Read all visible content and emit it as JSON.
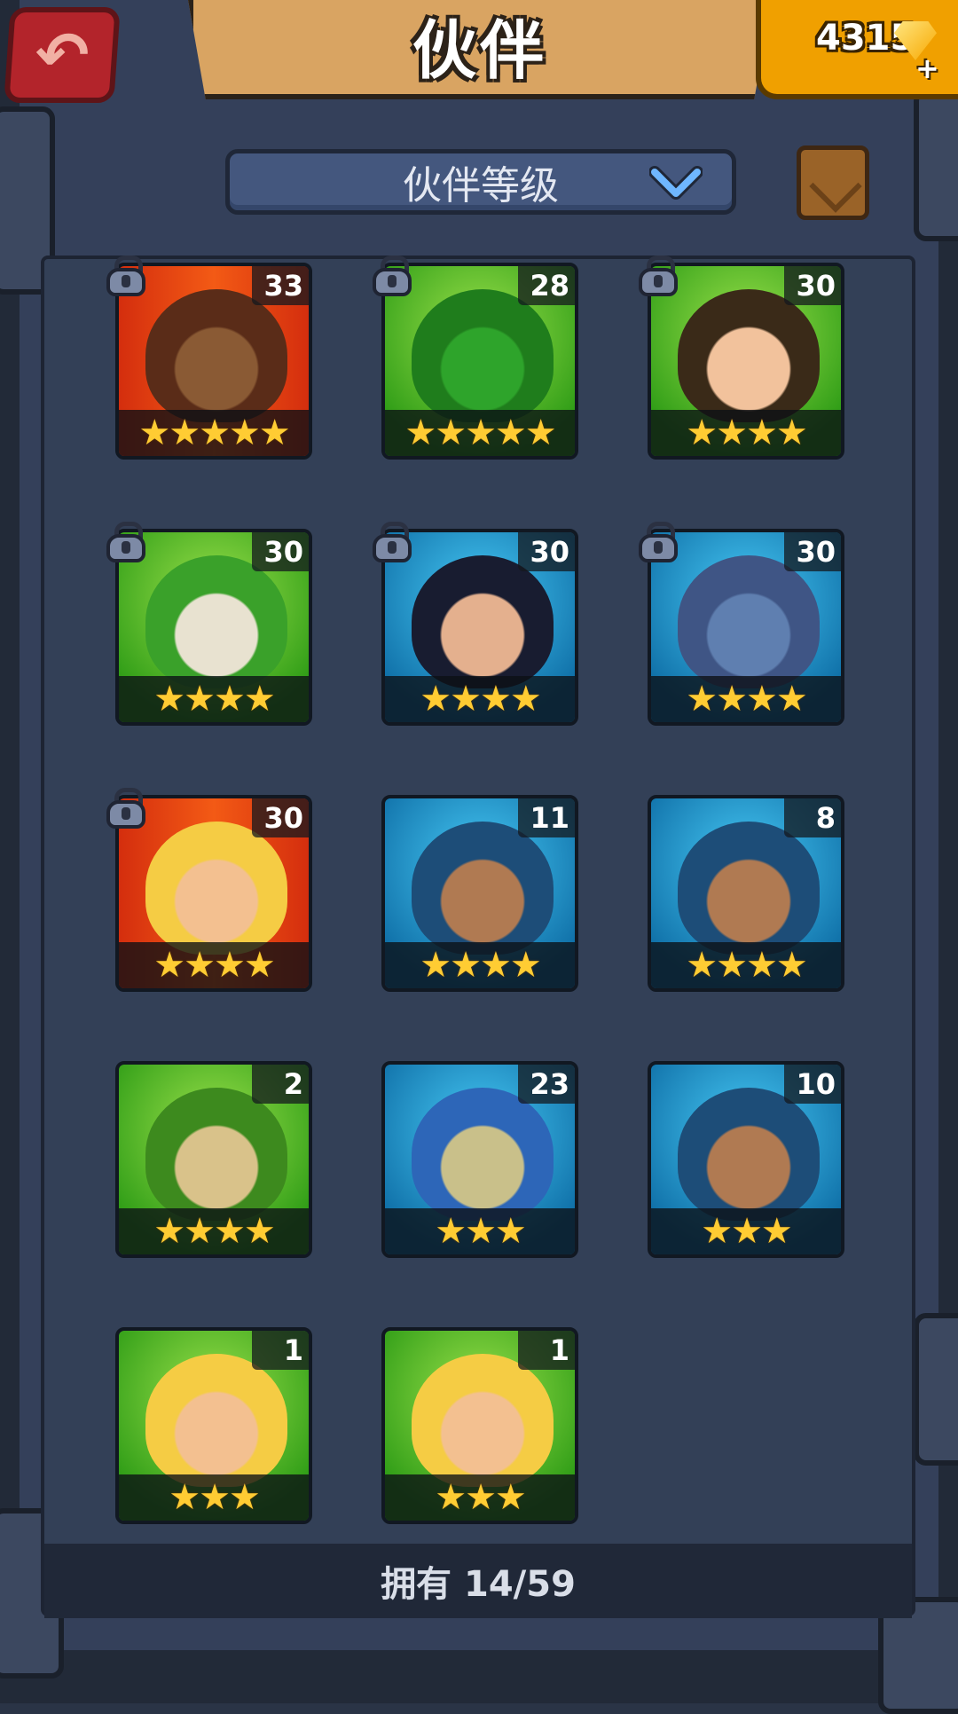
{
  "header": {
    "back_icon": "back-arrow-icon",
    "title": "伙伴",
    "gems": "4315",
    "gem_icon": "diamond-icon",
    "plus_icon": "plus-icon"
  },
  "sort": {
    "label": "伙伴等级",
    "chevron_icon": "chevron-down-icon",
    "scroll_icon": "scroll-icon"
  },
  "companions": [
    {
      "level": "33",
      "stars": "★★★★★",
      "bg": "red",
      "locked": true,
      "portrait": "brown-haired-man",
      "hair": "#5a2c18",
      "face": "#8a5a34"
    },
    {
      "level": "28",
      "stars": "★★★★★",
      "bg": "green",
      "locked": true,
      "portrait": "green-dragon",
      "hair": "#1f7d1c",
      "face": "#2ea42b"
    },
    {
      "level": "30",
      "stars": "★★★★",
      "bg": "green",
      "locked": true,
      "portrait": "dark-haired-woman",
      "hair": "#3a2a18",
      "face": "#f2c29c"
    },
    {
      "level": "30",
      "stars": "★★★★",
      "bg": "green",
      "locked": true,
      "portrait": "green-turtle-warrior",
      "hair": "#3aa12a",
      "face": "#e8e2d0"
    },
    {
      "level": "30",
      "stars": "★★★★",
      "bg": "blue",
      "locked": true,
      "portrait": "black-haired-woman",
      "hair": "#181c30",
      "face": "#e4b08e"
    },
    {
      "level": "30",
      "stars": "★★★★",
      "bg": "blue",
      "locked": true,
      "portrait": "blue-boar",
      "hair": "#3f5585",
      "face": "#5f7fb0"
    },
    {
      "level": "30",
      "stars": "★★★★",
      "bg": "red",
      "locked": true,
      "portrait": "blonde-woman",
      "hair": "#f5cc44",
      "face": "#f3c090"
    },
    {
      "level": "11",
      "stars": "★★★★",
      "bg": "blue",
      "locked": false,
      "portrait": "blue-haired-warrior",
      "hair": "#1d4d78",
      "face": "#b07a52"
    },
    {
      "level": "8",
      "stars": "★★★★",
      "bg": "blue",
      "locked": false,
      "portrait": "blue-haired-warrior",
      "hair": "#1d4d78",
      "face": "#b07a52"
    },
    {
      "level": "2",
      "stars": "★★★★",
      "bg": "green",
      "locked": false,
      "portrait": "green-lizard",
      "hair": "#3d8a1e",
      "face": "#d9c28a"
    },
    {
      "level": "23",
      "stars": "★★★",
      "bg": "blue",
      "locked": false,
      "portrait": "blue-lizard",
      "hair": "#2d66b8",
      "face": "#c9c08a"
    },
    {
      "level": "10",
      "stars": "★★★",
      "bg": "blue",
      "locked": false,
      "portrait": "blue-haired-warrior",
      "hair": "#1d4d78",
      "face": "#b07a52"
    },
    {
      "level": "1",
      "stars": "★★★",
      "bg": "green",
      "locked": false,
      "portrait": "blonde-woman",
      "hair": "#f5cc44",
      "face": "#f3c090"
    },
    {
      "level": "1",
      "stars": "★★★",
      "bg": "green",
      "locked": false,
      "portrait": "blonde-woman",
      "hair": "#f5cc44",
      "face": "#f3c090"
    }
  ],
  "footer": {
    "owned": "拥有 14/59"
  }
}
